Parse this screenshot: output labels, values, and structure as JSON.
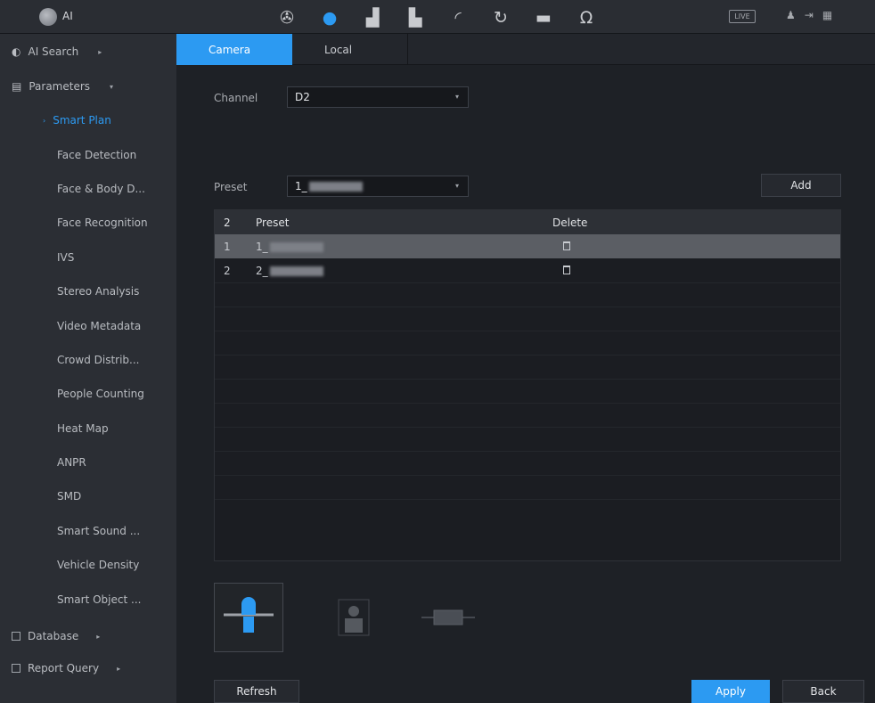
{
  "app": {
    "title": "AI"
  },
  "topbar": {
    "icons": [
      "film-reel-icon",
      "ai-head-icon",
      "alarm-icon",
      "storage-icon",
      "speedometer-icon",
      "refresh-icon",
      "monitor-icon",
      "headset-icon"
    ],
    "live_label": "LIVE",
    "right": [
      "user-icon",
      "logout-icon",
      "grid-icon"
    ]
  },
  "sidebar": {
    "ai_search": "AI Search",
    "parameters": "Parameters",
    "items": [
      "Smart Plan",
      "Face Detection",
      "Face & Body D...",
      "Face Recognition",
      "IVS",
      "Stereo Analysis",
      "Video Metadata",
      "Crowd Distrib...",
      "People Counting",
      "Heat Map",
      "ANPR",
      "SMD",
      "Smart Sound ...",
      "Vehicle Density",
      "Smart Object ..."
    ],
    "database": "Database",
    "report_query": "Report Query"
  },
  "tabs": [
    "Camera",
    "Local"
  ],
  "channel": {
    "label": "Channel",
    "value": "D2"
  },
  "preset": {
    "label": "Preset",
    "value": "1_"
  },
  "add_label": "Add",
  "table": {
    "headers": [
      "2",
      "Preset",
      "Delete"
    ],
    "rows": [
      {
        "idx": "1",
        "preset": "1_"
      },
      {
        "idx": "2",
        "preset": "2_"
      }
    ]
  },
  "footer": {
    "refresh": "Refresh",
    "apply": "Apply",
    "back": "Back"
  },
  "colors": {
    "accent": "#2c9af2",
    "background": "#1e2126",
    "sidebar": "#2b2e34"
  }
}
